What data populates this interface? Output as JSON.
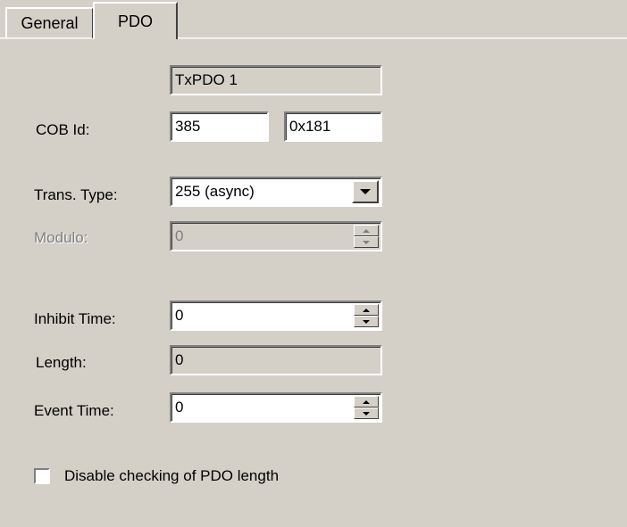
{
  "tabs": [
    {
      "label": "General",
      "active": false
    },
    {
      "label": "PDO",
      "active": true
    }
  ],
  "pdo_name": "TxPDO 1",
  "cob_id": {
    "label": "COB Id:",
    "decimal": "385",
    "hex": "0x181"
  },
  "trans_type": {
    "label": "Trans. Type:",
    "value": "255 (async)"
  },
  "modulo": {
    "label": "Modulo:",
    "value": "0",
    "enabled": false
  },
  "inhibit_time": {
    "label": "Inhibit Time:",
    "value": "0"
  },
  "length": {
    "label": "Length:",
    "value": "0"
  },
  "event_time": {
    "label": "Event Time:",
    "value": "0"
  },
  "disable_check": {
    "label": "Disable checking of PDO length",
    "checked": false
  },
  "colors": {
    "dialog_bg": "#d4d0c8",
    "disabled_text": "#808080"
  }
}
